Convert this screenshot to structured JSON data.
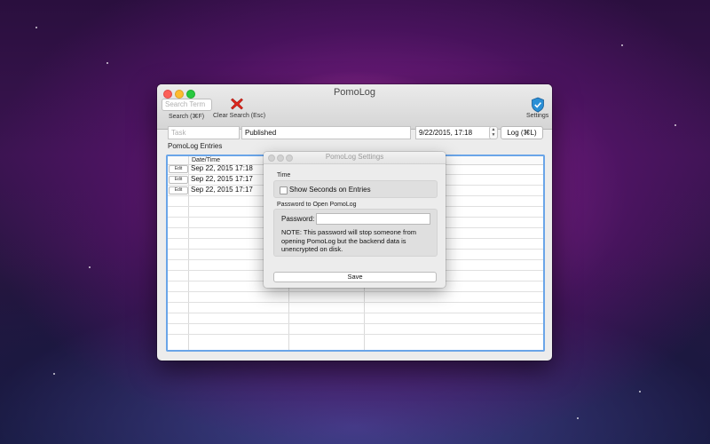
{
  "window": {
    "title": "PomoLog"
  },
  "toolbar": {
    "search_placeholder": "Search Term",
    "search_label": "Search (⌘F)",
    "clear_label": "Clear Search (Esc)",
    "settings_label": "Settings",
    "clear_icon": "red-x-icon",
    "settings_icon": "shield-icon"
  },
  "entry_form": {
    "task_placeholder": "Task",
    "task_value": "Published",
    "date_value": "9/22/2015, 17:18",
    "log_button": "Log (⌘L)"
  },
  "entries": {
    "title": "PomoLog Entries",
    "columns": [
      "",
      "Date/Time"
    ],
    "edit_label": "Edit",
    "rows": [
      {
        "datetime": "Sep 22, 2015 17:18"
      },
      {
        "datetime": "Sep 22, 2015 17:17"
      },
      {
        "datetime": "Sep 22, 2015 17:17"
      }
    ]
  },
  "settings_dialog": {
    "title": "PomoLog Settings",
    "time_section": "Time",
    "show_seconds_label": "Show Seconds on Entries",
    "show_seconds_checked": false,
    "password_section": "Password to Open PomoLog",
    "password_label": "Password:",
    "password_value": "",
    "note": "NOTE: This password will stop someone from opening PomoLog but the backend data is unencrypted on disk.",
    "save_button": "Save"
  },
  "colors": {
    "table_focus_border": "#6aa5e8",
    "close": "#fc5f57",
    "minimize": "#fdbc2e",
    "maximize": "#28c940",
    "clear_icon": "#e0281e",
    "shield": "#2a8fd6"
  }
}
